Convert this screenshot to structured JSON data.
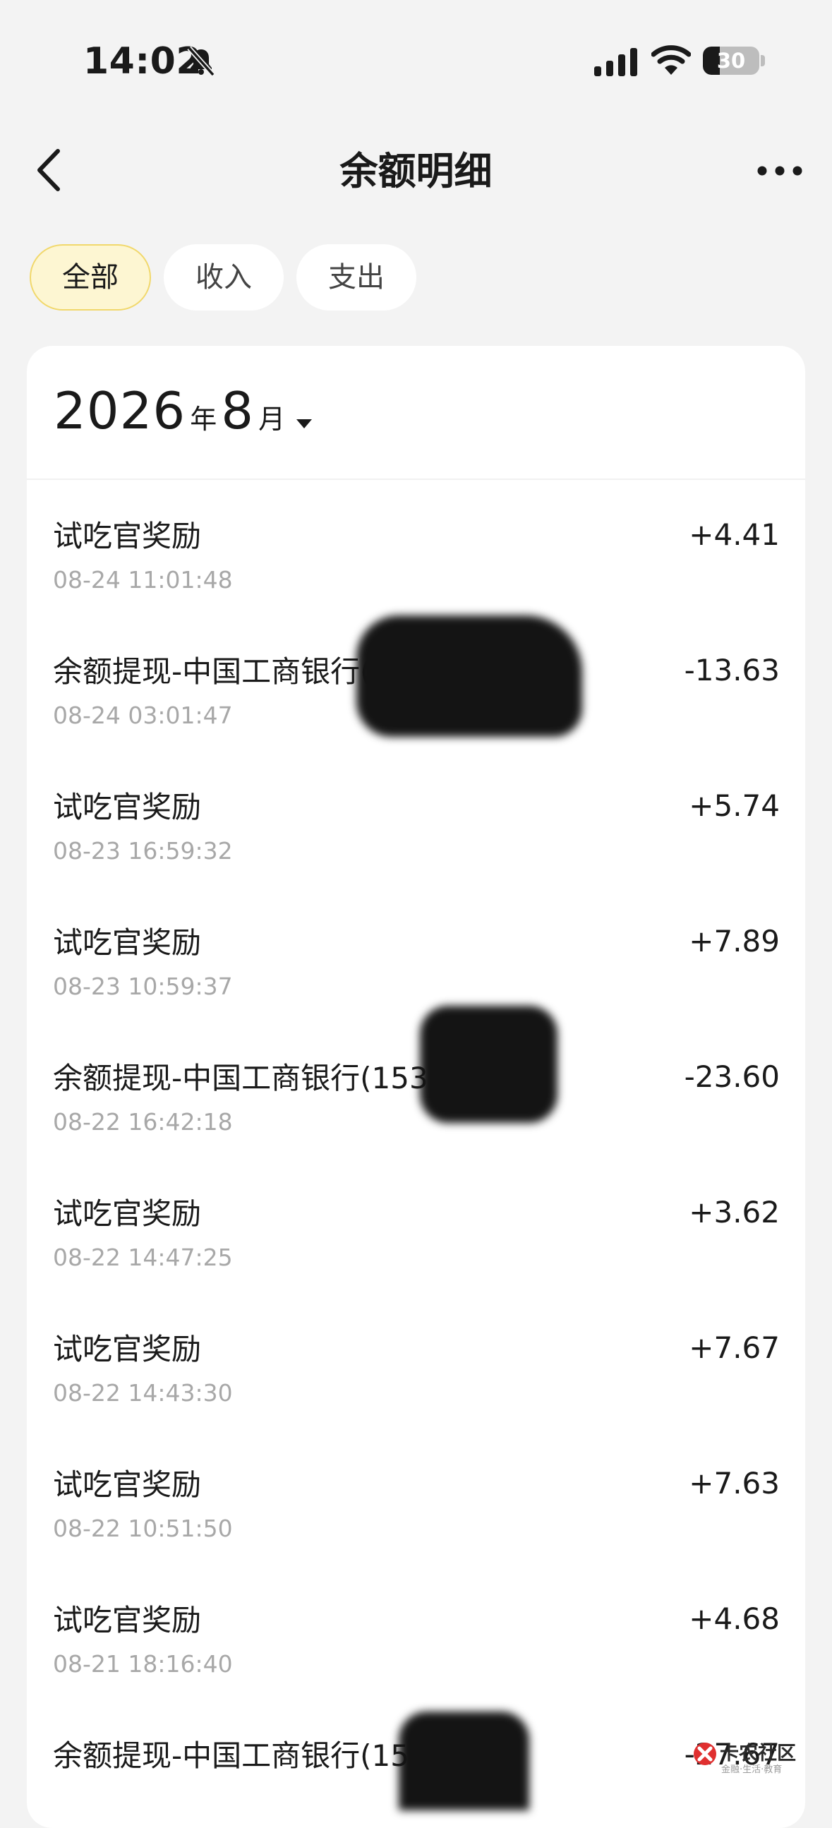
{
  "status_bar": {
    "time": "14:02",
    "battery_level": "30",
    "battery_fraction": 0.3,
    "icons": [
      "bell-muted-icon",
      "cellular-signal-icon",
      "wifi-icon",
      "battery-icon"
    ]
  },
  "nav": {
    "title": "余额明细",
    "back_icon": "chevron-left-icon",
    "more_icon": "more-dots-icon"
  },
  "tabs": [
    {
      "label": "全部",
      "active": true
    },
    {
      "label": "收入",
      "active": false
    },
    {
      "label": "支出",
      "active": false
    }
  ],
  "month_picker": {
    "year": "2026",
    "year_unit": "年",
    "month": "8",
    "month_unit": "月",
    "icon": "caret-down-icon"
  },
  "transactions": [
    {
      "title": "试吃官奖励",
      "time": "08-24 11:01:48",
      "amount": "+4.41"
    },
    {
      "title": "余额提现-中国工商银行(1538)**亮",
      "time": "08-24 03:01:47",
      "amount": "-13.63"
    },
    {
      "title": "试吃官奖励",
      "time": "08-23 16:59:32",
      "amount": "+5.74"
    },
    {
      "title": "试吃官奖励",
      "time": "08-23 10:59:37",
      "amount": "+7.89"
    },
    {
      "title": "余额提现-中国工商银行(1538)**亮",
      "time": "08-22 16:42:18",
      "amount": "-23.60"
    },
    {
      "title": "试吃官奖励",
      "time": "08-22 14:47:25",
      "amount": "+3.62"
    },
    {
      "title": "试吃官奖励",
      "time": "08-22 14:43:30",
      "amount": "+7.67"
    },
    {
      "title": "试吃官奖励",
      "time": "08-22 10:51:50",
      "amount": "+7.63"
    },
    {
      "title": "试吃官奖励",
      "time": "08-21 18:16:40",
      "amount": "+4.68"
    },
    {
      "title": "余额提现-中国工商银行(1538)**亮",
      "time": "",
      "amount": "-27.67"
    }
  ],
  "watermark": {
    "text": "卡农社区",
    "sub": "金融·生活·教育"
  },
  "colors": {
    "page_background": "#f3f3f3",
    "active_tab_background": "#fdf6d2",
    "active_tab_border": "#f1d86b",
    "text_primary": "#1a1a1a",
    "text_secondary": "#a8a8a8"
  }
}
